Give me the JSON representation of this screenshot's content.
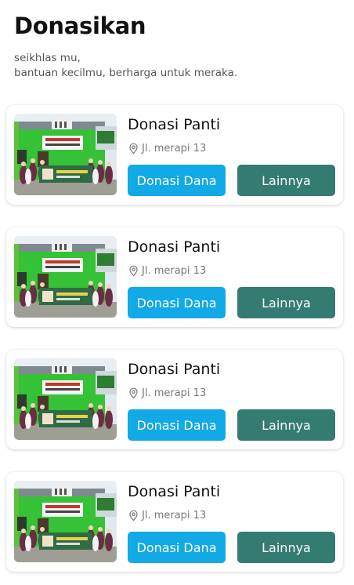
{
  "header": {
    "title": "Donasikan",
    "subtitle_line1": "seikhlas mu,",
    "subtitle_line2": "bantuan kecilmu, berharga untuk meraka."
  },
  "cards": [
    {
      "title": "Donasi Panti",
      "location": "Jl. merapi 13",
      "primary_label": "Donasi Dana",
      "secondary_label": "Lainnya"
    },
    {
      "title": "Donasi Panti",
      "location": "Jl. merapi 13",
      "primary_label": "Donasi Dana",
      "secondary_label": "Lainnya"
    },
    {
      "title": "Donasi Panti",
      "location": "Jl. merapi 13",
      "primary_label": "Donasi Dana",
      "secondary_label": "Lainnya"
    },
    {
      "title": "Donasi Panti",
      "location": "Jl. merapi 13",
      "primary_label": "Donasi Dana",
      "secondary_label": "Lainnya"
    }
  ],
  "colors": {
    "primary_button": "#11a9e6",
    "secondary_button": "#347b72",
    "location_text": "#777777"
  },
  "icons": {
    "location": "map-pin-icon"
  }
}
